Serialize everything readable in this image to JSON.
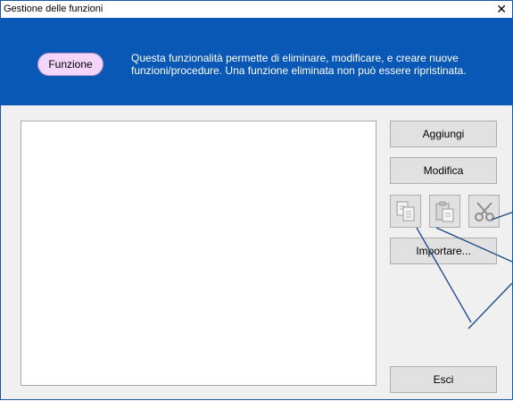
{
  "window": {
    "title": "Gestione delle funzioni",
    "close_glyph": "✕"
  },
  "banner": {
    "pill_label": "Funzione",
    "line1": "Questa funzionalità permette di eliminare, modificare, e creare nuove",
    "line2": "funzioni/procedure. Una funzione eliminata non può essere ripristinata."
  },
  "buttons": {
    "add": "Aggiungi",
    "edit": "Modifica",
    "import": "Importare...",
    "exit": "Esci"
  },
  "icons": {
    "copy": "copy-icon",
    "paste": "paste-icon",
    "cut": "cut-icon"
  },
  "colors": {
    "banner": "#0a58b6",
    "pill": "#f3d5fb",
    "callout_line": "#1f4e8c"
  }
}
